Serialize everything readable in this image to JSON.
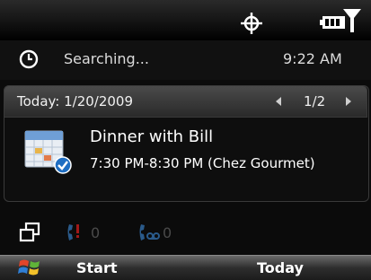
{
  "status": {
    "gps_icon": "gps-crosshair-icon",
    "battery_icon": "battery-icon",
    "signal_icon": "signal-icon"
  },
  "clock": {
    "icon": "clock-icon",
    "status_text": "Searching...",
    "time": "9:22 AM"
  },
  "calendar": {
    "date_label": "Today: 1/20/2009",
    "page_indicator": "1/2",
    "appointment": {
      "title": "Dinner with Bill",
      "time": "7:30 PM-8:30 PM (Chez Gourmet)"
    }
  },
  "notifications": {
    "missed_calls": "0",
    "voicemail": "0"
  },
  "softkeys": {
    "left": "Start",
    "right": "Today"
  },
  "colors": {
    "accent_blue": "#1f6ec2",
    "notif_dim": "#2a5a8a"
  }
}
